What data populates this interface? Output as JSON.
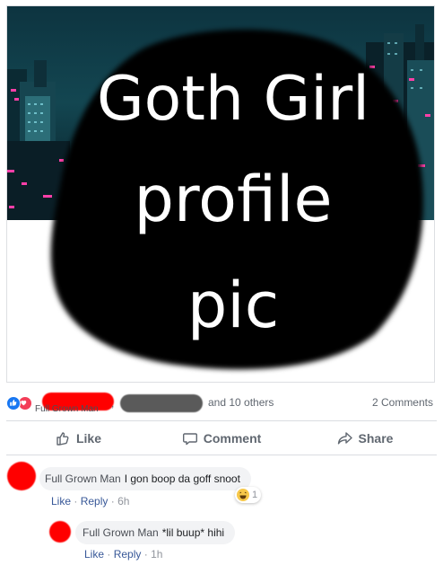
{
  "post": {
    "overlay_lines": [
      "Goth Girl",
      "profile",
      "pic"
    ]
  },
  "reactions": {
    "like_icon": "like-thumb-icon",
    "love_icon": "love-heart-icon",
    "name_under": "Full Grown Man",
    "comma": ",",
    "others": "and 10 others",
    "comments_count": "2 Comments"
  },
  "actions": {
    "like_label": "Like",
    "comment_label": "Comment",
    "share_label": "Share"
  },
  "comments": [
    {
      "author": "Full Grown Man",
      "text": "I gon boop da goff snoot",
      "like": "Like",
      "reply": "Reply",
      "sep": "·",
      "time": "6h",
      "reaction_icon": "haha-icon",
      "reaction_count": "1"
    },
    {
      "author": "Full Grown Man",
      "text": "*lil buup* hihi",
      "like": "Like",
      "reply": "Reply",
      "sep": "·",
      "time": "1h"
    }
  ],
  "colors": {
    "redaction": "#ff0000",
    "gray_redaction": "#5a5a5a",
    "facebook_blue": "#1877f2",
    "link_blue": "#385898",
    "muted_text": "#606770"
  }
}
